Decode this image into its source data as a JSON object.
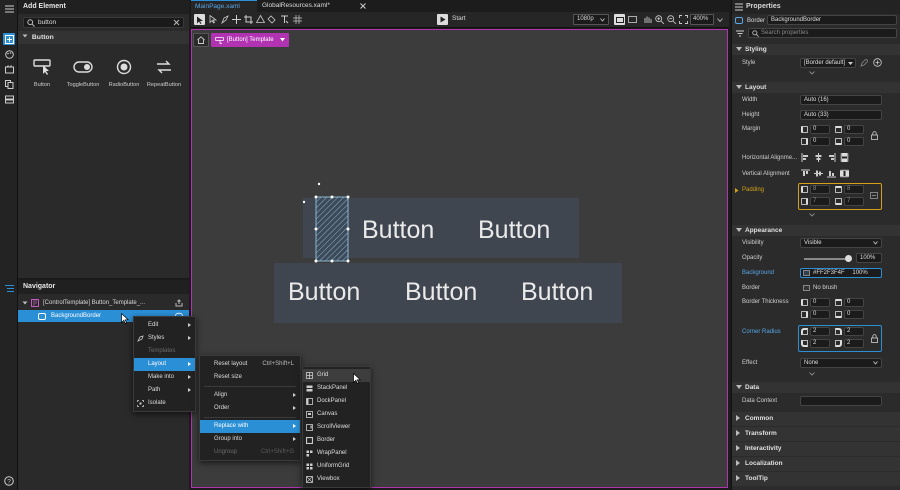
{
  "add_element": {
    "title": "Add Element",
    "search_value": "button",
    "section": "Button",
    "controls": [
      {
        "label": "Button",
        "icon": "button-icon"
      },
      {
        "label": "ToggleButton",
        "icon": "toggle-icon"
      },
      {
        "label": "RadioButton",
        "icon": "radio-icon"
      },
      {
        "label": "RepeatButton",
        "icon": "repeat-icon"
      }
    ]
  },
  "navigator": {
    "title": "Navigator",
    "root": "[ControlTemplate] Button_Template_...",
    "child": "BackgroundBorder"
  },
  "tabs": [
    {
      "label": "MainPage.xaml",
      "active": true
    },
    {
      "label": "GlobalResources.xaml*",
      "active": false
    }
  ],
  "toolbar": {
    "start_label": "Start",
    "resolution": "1080p",
    "zoom": "400%"
  },
  "breadcrumb": {
    "template_label": "[Button] Template"
  },
  "canvas": {
    "buttons_row1": [
      "Button",
      "Button"
    ],
    "buttons_row2": [
      "Button",
      "Button",
      "Button"
    ]
  },
  "context_menu": {
    "items": [
      "Edit",
      "Styles",
      "Templates",
      "Layout",
      "Make into",
      "Path",
      "Isolate"
    ]
  },
  "layout_menu": {
    "items": [
      {
        "label": "Reset layout",
        "shortcut": "Ctrl+Shift+L"
      },
      {
        "label": "Reset size",
        "shortcut": ""
      },
      {
        "label": "Align",
        "shortcut": ""
      },
      {
        "label": "Order",
        "shortcut": ""
      },
      {
        "label": "Replace with",
        "shortcut": ""
      },
      {
        "label": "Group into",
        "shortcut": ""
      },
      {
        "label": "Ungroup",
        "shortcut": "Ctrl+Shift+G"
      }
    ]
  },
  "replace_menu": {
    "items": [
      "Grid",
      "StackPanel",
      "DockPanel",
      "Canvas",
      "ScrollViewer",
      "Border",
      "WrapPanel",
      "UniformGrid",
      "Viewbox"
    ]
  },
  "properties": {
    "title": "Properties",
    "element_type": "Border",
    "element_name": "BackgroundBorder",
    "search_placeholder": "Search properties",
    "styling": {
      "header": "Styling",
      "style_label": "Style",
      "style_value": "[Border default]"
    },
    "layout": {
      "header": "Layout",
      "width_label": "Width",
      "width_value": "Auto (16)",
      "height_label": "Height",
      "height_value": "Auto (33)",
      "margin_label": "Margin",
      "margin_values": [
        "0",
        "0",
        "0",
        "0"
      ],
      "halign_label": "Horizontal Alignme...",
      "valign_label": "Vertical Alignment",
      "padding_label": "Padding",
      "padding_values": [
        "8",
        "8",
        "7",
        "7"
      ]
    },
    "appearance": {
      "header": "Appearance",
      "visibility_label": "Visibility",
      "visibility_value": "Visible",
      "opacity_label": "Opacity",
      "opacity_value": "100%",
      "background_label": "Background",
      "background_value": "#FF2F3F4F",
      "background_pct": "100%",
      "border_label": "Border",
      "border_value": "No brush",
      "thickness_label": "Border Thickness",
      "thickness_values": [
        "0",
        "0",
        "0",
        "0"
      ],
      "radius_label": "Corner Radius",
      "radius_values": [
        "2",
        "2",
        "2",
        "2"
      ],
      "effect_label": "Effect",
      "effect_value": "None"
    },
    "data": {
      "header": "Data",
      "context_label": "Data Context"
    },
    "collapsed_groups": [
      "Common",
      "Transform",
      "Interactivity",
      "Localization",
      "ToolTip"
    ]
  },
  "colors": {
    "accent": "#2b8fd6",
    "selection_magenta": "#b133b1",
    "padding_highlight": "#d4a017",
    "canvas_bg": "#3c3c3c"
  }
}
